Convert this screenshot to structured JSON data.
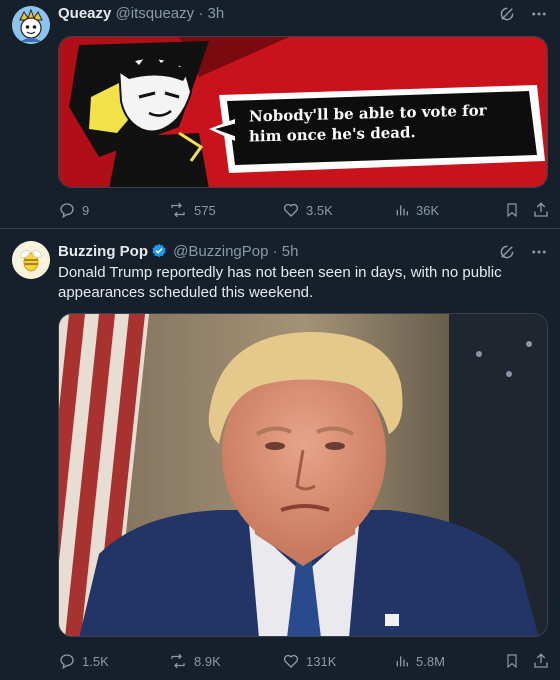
{
  "tweets": [
    {
      "display_name": "Queazy",
      "handle": "@itsqueazy",
      "time": "3h",
      "media_caption": "Nobody'll be able to vote for him once he's dead.",
      "stats": {
        "replies": "9",
        "reposts": "575",
        "likes": "3.5K",
        "views": "36K"
      }
    },
    {
      "display_name": "Buzzing Pop",
      "handle": "@BuzzingPop",
      "time": "5h",
      "verified": true,
      "text": "Donald Trump reportedly has not been seen in days, with no public appearances scheduled this weekend.",
      "stats": {
        "replies": "1.5K",
        "reposts": "8.9K",
        "likes": "131K",
        "views": "5.8M"
      }
    }
  ],
  "colors": {
    "background": "#15202b",
    "text_secondary": "#8b98a5",
    "verified_blue": "#1d9bf0",
    "divider": "#38444d"
  },
  "icons": [
    "grok-icon",
    "more-icon",
    "reply-icon",
    "repost-icon",
    "like-icon",
    "views-icon",
    "bookmark-icon",
    "share-icon",
    "verified-badge-icon"
  ]
}
